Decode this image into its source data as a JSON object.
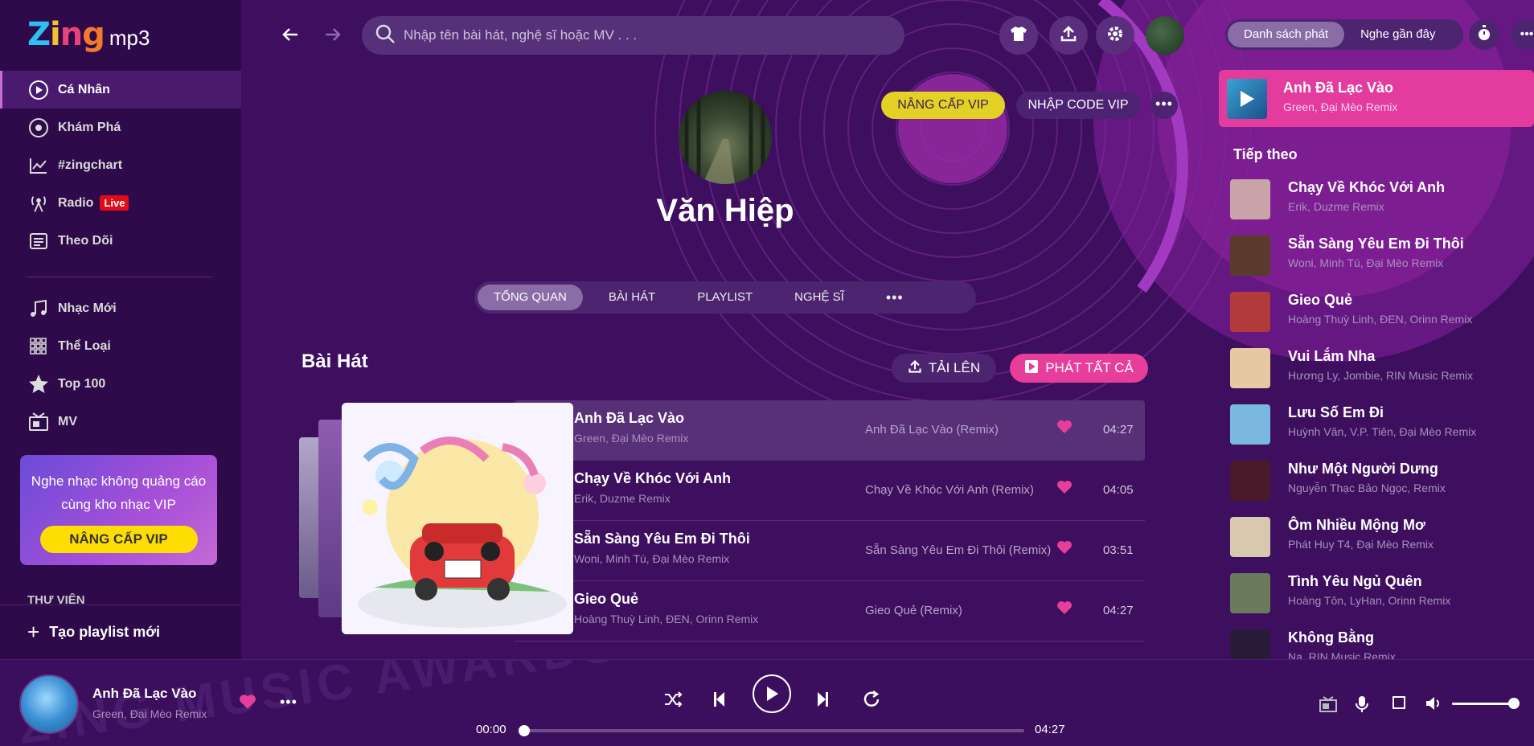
{
  "logo": {
    "brand": "Zing",
    "product": "mp3"
  },
  "sidebar": {
    "items": [
      {
        "label": "Cá Nhân",
        "icon": "personal-icon"
      },
      {
        "label": "Khám Phá",
        "icon": "disc-icon"
      },
      {
        "label": "#zingchart",
        "icon": "chart-icon"
      },
      {
        "label": "Radio",
        "icon": "radio-icon",
        "badge": "Live"
      },
      {
        "label": "Theo Dõi",
        "icon": "list-icon"
      },
      {
        "label": "Nhạc Mới",
        "icon": "music-note-icon"
      },
      {
        "label": "Thể Loại",
        "icon": "grid-icon"
      },
      {
        "label": "Top 100",
        "icon": "star-icon"
      },
      {
        "label": "MV",
        "icon": "video-icon"
      }
    ],
    "vip_text_1": "Nghe nhạc không quảng cáo",
    "vip_text_2": "cùng kho nhạc VIP",
    "vip_button": "NÂNG CẤP VIP",
    "library_label": "THƯ VIỆN",
    "new_playlist": "Tạo playlist mới"
  },
  "header": {
    "search_placeholder": "Nhập tên bài hát, nghệ sĩ hoặc MV . . ."
  },
  "profile": {
    "name": "Văn Hiệp",
    "vip_button": "NÂNG CẤP VIP",
    "code_button": "NHẬP CODE VIP",
    "tabs": [
      "TỔNG QUAN",
      "BÀI HÁT",
      "PLAYLIST",
      "NGHỆ SĨ"
    ]
  },
  "songs_section": {
    "title": "Bài Hát",
    "upload_button": "TẢI LÊN",
    "play_all_button": "PHÁT TẤT CẢ",
    "rows": [
      {
        "title": "Anh Đã Lạc Vào",
        "artist": "Green, Đại Mèo Remix",
        "album": "Anh Đã Lạc Vào (Remix)",
        "duration": "04:27"
      },
      {
        "title": "Chạy Về Khóc Với Anh",
        "artist": "Erik, Duzme Remix",
        "album": "Chạy Về Khóc Với Anh (Remix)",
        "duration": "04:05"
      },
      {
        "title": "Sẵn Sàng Yêu Em Đi Thôi",
        "artist": "Woni, Minh Tú, Đại Mèo Remix",
        "album": "Sẵn Sàng Yêu Em Đi Thôi (Remix)",
        "duration": "03:51"
      },
      {
        "title": "Gieo Quẻ",
        "artist": "Hoàng Thuỳ Linh, ĐEN, Orinn Remix",
        "album": "Gieo Quẻ (Remix)",
        "duration": "04:27"
      }
    ]
  },
  "right_panel": {
    "tab_playlist": "Danh sách phát",
    "tab_recent": "Nghe gần đây",
    "now_playing": {
      "title": "Anh Đã Lạc Vào",
      "artist": "Green, Đại Mèo Remix"
    },
    "next_label": "Tiếp theo",
    "queue": [
      {
        "title": "Chạy Về Khóc Với Anh",
        "artist": "Erik, Duzme Remix",
        "color": "#c9a3a8"
      },
      {
        "title": "Sẵn Sàng Yêu Em Đi Thôi",
        "artist": "Woni, Minh Tú, Đại Mèo Remix",
        "color": "#5a3a2a"
      },
      {
        "title": "Gieo Quẻ",
        "artist": "Hoàng Thuỳ Linh, ĐEN, Orinn Remix",
        "color": "#b23a3a"
      },
      {
        "title": "Vui Lắm Nha",
        "artist": "Hương Ly, Jombie, RIN Music Remix",
        "color": "#e6c9a0"
      },
      {
        "title": "Lưu Số Em Đi",
        "artist": "Huỳnh Văn, V.P. Tiên, Đại Mèo Remix",
        "color": "#7ab8e0"
      },
      {
        "title": "Như Một Người Dưng",
        "artist": "Nguyễn Thạc Bảo Ngọc, Remix",
        "color": "#4a1a2a"
      },
      {
        "title": "Ôm Nhiều Mộng Mơ",
        "artist": "Phát Huy T4, Đại Mèo Remix",
        "color": "#d8c8b0"
      },
      {
        "title": "Tình Yêu Ngủ Quên",
        "artist": "Hoàng Tôn, LyHan, Orinn Remix",
        "color": "#6a7a5a"
      },
      {
        "title": "Không Bằng",
        "artist": "Na, RIN Music Remix",
        "color": "#2a1a3a"
      }
    ]
  },
  "player": {
    "title": "Anh Đã Lạc Vào",
    "artist": "Green, Đại Mèo Remix",
    "time_current": "00:00",
    "time_total": "04:27",
    "progress": 0,
    "volume": 1,
    "watermark": "ZING MUSIC AWARDS"
  },
  "colors": {
    "accent_pink": "#e83e9b",
    "vip_yellow": "#fedd02",
    "bg_purple": "#3d0f5e"
  }
}
